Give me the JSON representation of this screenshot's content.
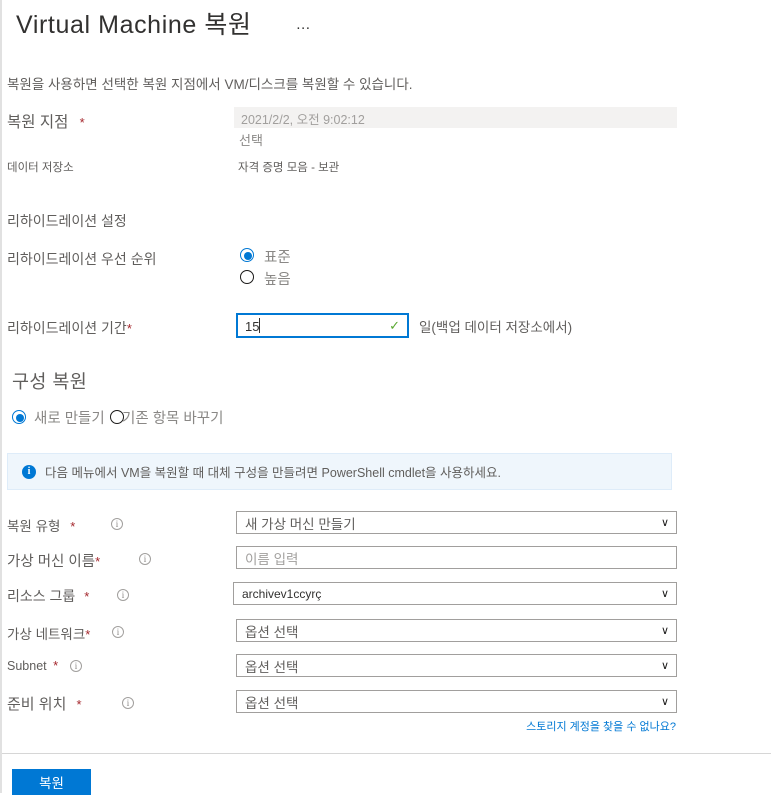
{
  "blade": {
    "title": "Virtual Machine 복원",
    "more_menu": "…",
    "description": "복원을 사용하면 선택한 복원 지점에서 VM/디스크를 복원할 수 있습니다."
  },
  "recovery_point": {
    "label": "복원 지점",
    "required_mark": "*",
    "value": "2021/2/2, 오전 9:02:12",
    "select_link": "선택"
  },
  "data_store": {
    "label": "데이터 저장소",
    "value": "자격 증명 모음 - 보관"
  },
  "rehydration": {
    "section_label": "리하이드레이션 설정",
    "priority_label": "리하이드레이션 우선 순위",
    "priority_options": [
      {
        "label": "표준",
        "selected": true
      },
      {
        "label": "높음",
        "selected": false
      }
    ],
    "duration_label": "리하이드레이션 기간",
    "duration_required": "*",
    "duration_value": "15",
    "duration_unit": "일(백업 데이터 저장소에서)",
    "valid_icon": "✓"
  },
  "restore_configuration": {
    "heading": "구성 복원",
    "options": [
      {
        "label": "새로 만들기",
        "selected": true
      },
      {
        "label": "기존 항목 바꾸기",
        "selected": false
      }
    ],
    "info_icon": "i",
    "info_message": "다음 메뉴에서 VM을 복원할 때 대체 구성을 만들려면 PowerShell cmdlet을 사용하세요."
  },
  "fields": [
    {
      "label": "복원 유형",
      "required": "*",
      "has_info": true,
      "type": "select",
      "value": "새 가상 머신 만들기",
      "placeholder": false
    },
    {
      "label": "가상 머신 이름",
      "required": "*",
      "has_info": true,
      "type": "text",
      "value": "이름 입력",
      "placeholder": true
    },
    {
      "label": "리소스 그룹",
      "required": "*",
      "has_info": true,
      "type": "select",
      "value": "archivev1ccyrç",
      "placeholder": false
    },
    {
      "label": "가상 네트워크",
      "required": "*",
      "has_info": true,
      "type": "select",
      "value": "옵션 선택",
      "placeholder": false
    },
    {
      "label": "Subnet",
      "required": "*",
      "has_info": true,
      "type": "select",
      "value": "옵션 선택",
      "placeholder": false
    },
    {
      "label": "준비 위치",
      "required": "*",
      "has_info": true,
      "type": "select",
      "value": "옵션 선택",
      "placeholder": false
    }
  ],
  "help_link": "스토리지 계정을 찾을 수 없나요?",
  "footer": {
    "primary_button": "복원"
  },
  "colors": {
    "accent": "#0078d4",
    "required": "#a4262c",
    "valid": "#5aa832",
    "info_bg": "#eff6fc",
    "label": "#605e5c"
  },
  "chevron_glyph": "∨"
}
